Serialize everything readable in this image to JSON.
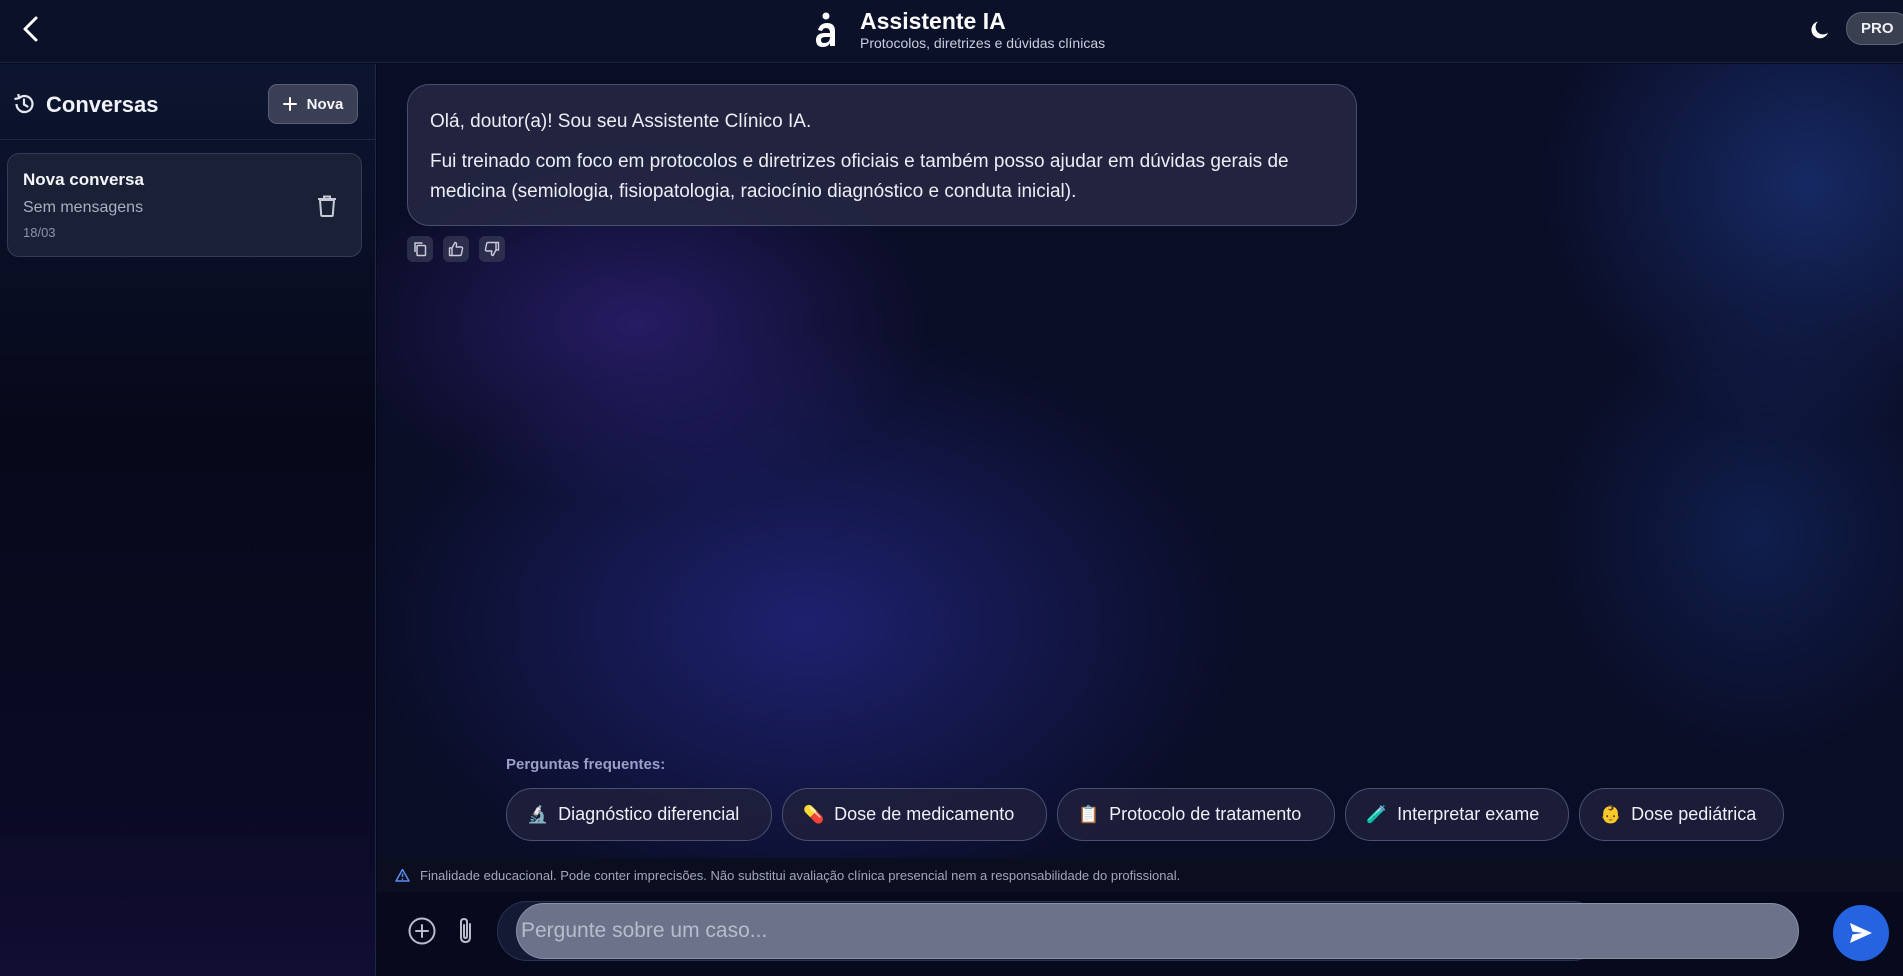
{
  "header": {
    "back_icon": "chevron-left-icon",
    "title": "Assistente IA",
    "subtitle": "Protocolos, diretrizes e dúvidas clínicas",
    "theme_icon": "moon-icon",
    "badge": "PRO"
  },
  "sidebar": {
    "title": "Conversas",
    "new_label": "Nova",
    "conversations": [
      {
        "title": "Nova conversa",
        "preview": "Sem mensagens",
        "date": "18/03"
      }
    ]
  },
  "chat": {
    "messages": [
      {
        "role": "assistant",
        "paragraphs": [
          "Olá, doutor(a)! Sou seu Assistente Clínico IA.",
          "Fui treinado com foco em protocolos e diretrizes oficiais e também posso ajudar em dúvidas gerais de medicina (semiologia, fisiopatologia, raciocínio diagnóstico e conduta inicial)."
        ]
      }
    ],
    "faq_label": "Perguntas frequentes:",
    "faq_chips": [
      {
        "emoji": "🔬",
        "label": "Diagnóstico diferencial"
      },
      {
        "emoji": "💊",
        "label": "Dose de medicamento"
      },
      {
        "emoji": "📋",
        "label": "Protocolo de tratamento"
      },
      {
        "emoji": "🧪",
        "label": "Interpretar exame"
      },
      {
        "emoji": "👶",
        "label": "Dose pediátrica"
      }
    ]
  },
  "disclaimer": "Finalidade educacional. Pode conter imprecisões. Não substitui avaliação clínica presencial nem a responsabilidade do profissional.",
  "composer": {
    "placeholder": "Pergunte sobre um caso...",
    "value": ""
  },
  "colors": {
    "accent": "#2563e0",
    "background": "#0a0d26"
  }
}
